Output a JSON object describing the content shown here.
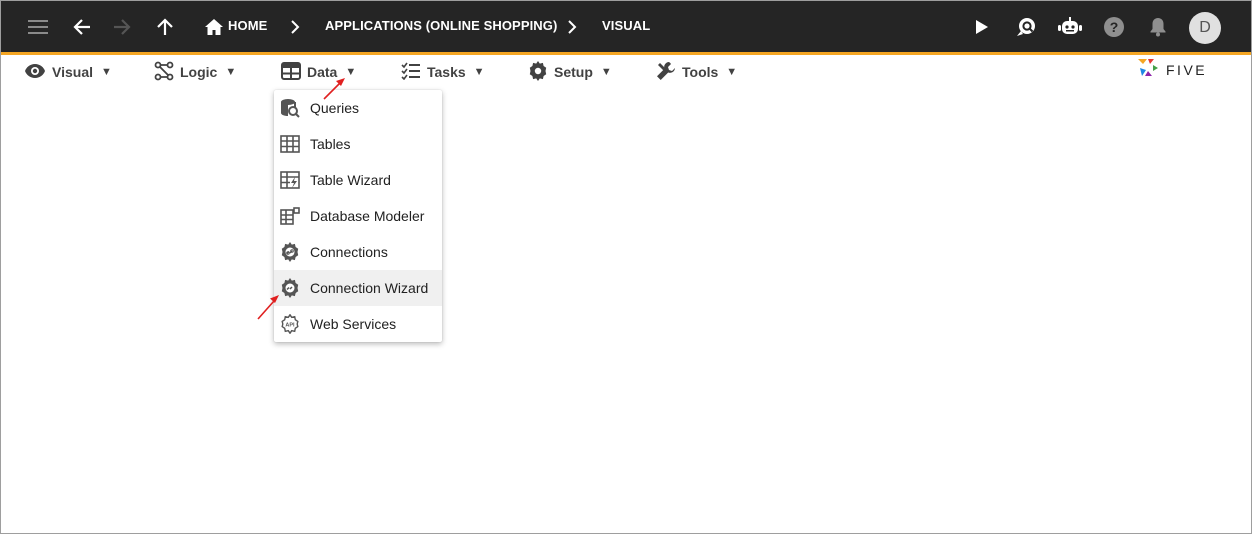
{
  "topbar": {
    "breadcrumbs": [
      "HOME",
      "APPLICATIONS (ONLINE SHOPPING)",
      "VISUAL"
    ],
    "avatar_initial": "D",
    "accent_color": "#f5a623",
    "background_color": "#252525"
  },
  "menubar": {
    "items": [
      {
        "label": "Visual",
        "icon": "eye-icon"
      },
      {
        "label": "Logic",
        "icon": "flow-icon"
      },
      {
        "label": "Data",
        "icon": "table-grid-icon"
      },
      {
        "label": "Tasks",
        "icon": "checklist-icon"
      },
      {
        "label": "Setup",
        "icon": "gear-icon"
      },
      {
        "label": "Tools",
        "icon": "wrench-icon"
      }
    ],
    "caret": "▼"
  },
  "logo": {
    "text": "FIVE"
  },
  "data_menu": {
    "items": [
      {
        "label": "Queries",
        "icon": "database-search-icon"
      },
      {
        "label": "Tables",
        "icon": "table-icon"
      },
      {
        "label": "Table Wizard",
        "icon": "table-wizard-icon"
      },
      {
        "label": "Database Modeler",
        "icon": "database-modeler-icon"
      },
      {
        "label": "Connections",
        "icon": "connections-gear-icon"
      },
      {
        "label": "Connection Wizard",
        "icon": "connection-wizard-icon"
      },
      {
        "label": "Web Services",
        "icon": "api-gear-icon"
      }
    ],
    "highlighted": "Connection Wizard"
  },
  "annotation_color": "#e02020"
}
